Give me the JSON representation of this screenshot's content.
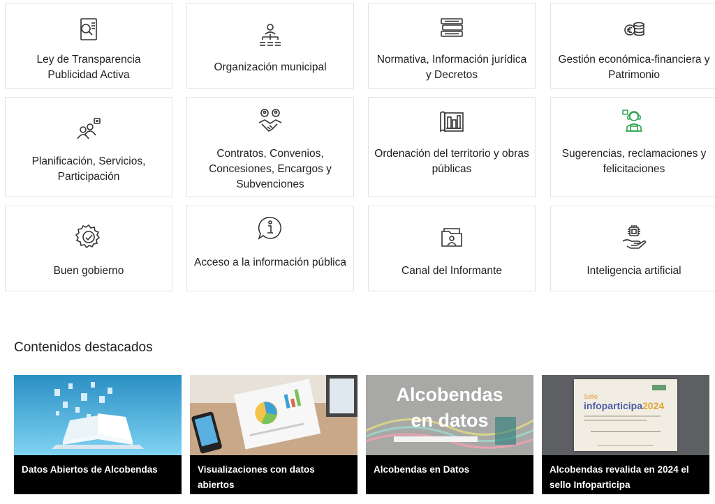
{
  "cards": [
    {
      "icon": "transparency-document-icon",
      "label": "Ley de Transparencia Publicidad Activa"
    },
    {
      "icon": "org-chart-icon",
      "label": "Organización municipal"
    },
    {
      "icon": "books-stack-icon",
      "label": "Normativa, Información jurídica y Decretos"
    },
    {
      "icon": "euro-coins-icon",
      "label": "Gestión económica-financiera y Patrimonio"
    },
    {
      "icon": "people-chat-icon",
      "label": "Planificación, Servicios, Participación"
    },
    {
      "icon": "handshake-icon",
      "label": "Contratos, Convenios, Concesiones, Encargos y Subvenciones"
    },
    {
      "icon": "city-blueprint-icon",
      "label": "Ordenación del territorio y obras públicas"
    },
    {
      "icon": "support-agent-icon",
      "label": "Sugerencias, reclamaciones y felicitaciones"
    },
    {
      "icon": "good-governance-gear-icon",
      "label": "Buen gobierno"
    },
    {
      "icon": "info-bubble-icon",
      "label": "Acceso a la información pública"
    },
    {
      "icon": "folder-person-icon",
      "label": "Canal del Informante"
    },
    {
      "icon": "ai-chip-hand-icon",
      "label": "Inteligencia artificial"
    }
  ],
  "featured": {
    "title": "Contenidos destacados",
    "items": [
      {
        "image": "open-book-data-image",
        "caption": "Datos Abiertos de Alcobendas"
      },
      {
        "image": "charts-visualization-image",
        "caption": "Visualizaciones con datos abiertos"
      },
      {
        "image": "alcobendas-en-datos-banner",
        "caption": "Alcobendas en Datos",
        "banner_line1": "Alcobendas",
        "banner_line2": "en datos"
      },
      {
        "image": "infoparticipa-certificate-image",
        "caption": "Alcobendas revalida en 2024 el sello Infoparticipa",
        "cert_small": "Sello",
        "cert_brand": "infoparticipa",
        "cert_year": "2024"
      }
    ]
  },
  "colors": {
    "icon": "#333333",
    "accent_green": "#2ea44f",
    "caption_bg": "#000000"
  }
}
